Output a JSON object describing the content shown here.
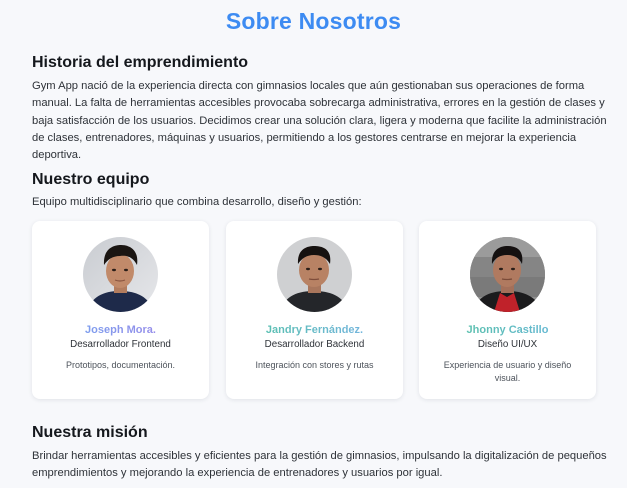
{
  "page": {
    "title": "Sobre Nosotros"
  },
  "history": {
    "heading": "Historia del emprendimiento",
    "text": "Gym App nació de la experiencia directa con gimnasios locales que aún gestionaban sus operaciones de forma manual. La falta de herramientas accesibles provocaba sobrecarga administrativa, errores en la gestión de clases y baja satisfacción de los usuarios. Decidimos crear una solución clara, ligera y moderna que facilite la administración de clases, entrenadores, máquinas y usuarios, permitiendo a los gestores centrarse en mejorar la experiencia deportiva."
  },
  "team": {
    "heading": "Nuestro equipo",
    "intro": "Equipo multidisciplinario que combina desarrollo, diseño y gestión:",
    "members": [
      {
        "name": "Joseph Mora.",
        "role": "Desarrollador Frontend",
        "description": "Prototipos, documentación.",
        "name_gradient": [
          "#6aa8f0",
          "#a983e8"
        ],
        "avatar_icon": "person-photo-icon"
      },
      {
        "name": "Jandry Fernández.",
        "role": "Desarrollador Backend",
        "description": "Integración con stores y rutas",
        "name_gradient": [
          "#4fc3a1",
          "#7fb2ee"
        ],
        "avatar_icon": "person-photo-icon"
      },
      {
        "name": "Jhonny Castillo",
        "role": "Diseño UI/UX",
        "description": "Experiencia de usuario y diseño visual.",
        "name_gradient": [
          "#57c59b",
          "#6ab4e6"
        ],
        "avatar_icon": "person-photo-icon"
      }
    ]
  },
  "mission": {
    "heading": "Nuestra misión",
    "text": "Brindar herramientas accesibles y eficientes para la gestión de gimnasios, impulsando la digitalización de pequeños emprendimientos y mejorando la experiencia de entrenadores y usuarios por igual."
  },
  "colors": {
    "accent": "#3d8bf2",
    "background": "#f7f8fb",
    "card": "#ffffff"
  }
}
